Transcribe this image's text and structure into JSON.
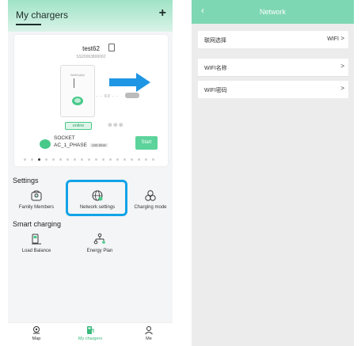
{
  "left": {
    "header": {
      "title": "My chargers",
      "add_label": "+"
    },
    "charger": {
      "name": "test62",
      "serial": "SS20063800062",
      "device_brand": "WaiSingNyi",
      "status": "online",
      "connector_circles": "⊕⊕⊕",
      "socket": "SOCKET",
      "phase": "AC_1_PHASE",
      "power": "100.0kW",
      "start_label": "Start",
      "distance_label": "- - 60 - -",
      "page_count": 19,
      "page_index": 2
    },
    "settings": {
      "title": "Settings",
      "items": [
        {
          "label": "Family Members",
          "icon": "family-icon"
        },
        {
          "label": "Network settings",
          "icon": "globe-icon"
        },
        {
          "label": "Charging mode",
          "icon": "mode-icon"
        }
      ]
    },
    "smart": {
      "title": "Smart charging",
      "items": [
        {
          "label": "Load Balance",
          "icon": "load-balance-icon"
        },
        {
          "label": "Energy Plan",
          "icon": "energy-plan-icon"
        }
      ]
    },
    "tabs": [
      {
        "label": "Map",
        "icon": "map-icon",
        "active": false
      },
      {
        "label": "My chargers",
        "icon": "charger-icon",
        "active": true
      },
      {
        "label": "Me",
        "icon": "person-icon",
        "active": false
      }
    ],
    "accent": "#48c98a",
    "highlight_color": "#13a3e7"
  },
  "right": {
    "header": {
      "title": "Network",
      "back": "‹"
    },
    "rows": [
      {
        "label": "联网选择",
        "value": "WIFI",
        "chevron": ">"
      },
      {
        "label": "WIFI名称",
        "value": "",
        "chevron": ">"
      },
      {
        "label": "WIFI密码",
        "value": "",
        "chevron": ">"
      }
    ],
    "accent": "#7ed7b3"
  }
}
